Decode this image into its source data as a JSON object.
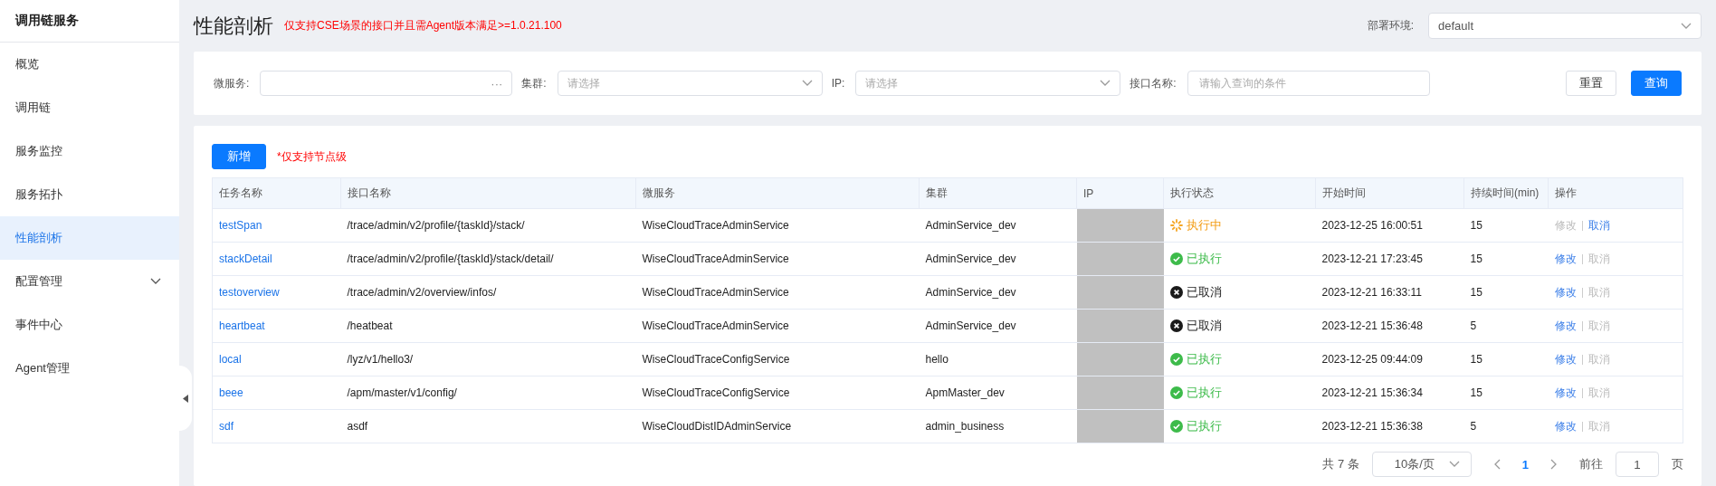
{
  "sidebar": {
    "title": "调用链服务",
    "items": [
      {
        "label": "概览",
        "selected": false
      },
      {
        "label": "调用链",
        "selected": false
      },
      {
        "label": "服务监控",
        "selected": false
      },
      {
        "label": "服务拓扑",
        "selected": false
      },
      {
        "label": "性能剖析",
        "selected": true
      },
      {
        "label": "配置管理",
        "selected": false,
        "expanded": false
      },
      {
        "label": "事件中心",
        "selected": false
      },
      {
        "label": "Agent管理",
        "selected": false
      }
    ]
  },
  "header": {
    "title": "性能剖析",
    "notice": "仅支持CSE场景的接口并且需Agent版本满足>=1.0.21.100",
    "env_label": "部署环境:",
    "env_value": "default"
  },
  "filters": [
    {
      "kind": "picker",
      "label": "微服务:",
      "suffix": "···"
    },
    {
      "kind": "select",
      "label": "集群:",
      "placeholder": "请选择"
    },
    {
      "kind": "select",
      "label": "IP:",
      "placeholder": "请选择"
    },
    {
      "kind": "input",
      "label": "接口名称:",
      "placeholder": "请输入查询的条件"
    }
  ],
  "filter_buttons": {
    "reset": "重置",
    "query": "查询"
  },
  "add_button": "新增",
  "add_note": "*仅支持节点级",
  "table": {
    "columns": [
      "任务名称",
      "接口名称",
      "微服务",
      "集群",
      "IP",
      "执行状态",
      "开始时间",
      "持续时间(min)",
      "操作"
    ],
    "rows": [
      {
        "task": "testSpan",
        "api": "/trace/admin/v2/profile/{taskId}/stack/",
        "service": "WiseCloudTraceAdminService",
        "cluster": "AdminService_dev",
        "status": {
          "kind": "running",
          "text": "执行中"
        },
        "start": "2023-12-25 16:00:51",
        "duration": "15",
        "edit": {
          "label": "修改",
          "disabled": true
        },
        "cancel": {
          "label": "取消",
          "disabled": false
        }
      },
      {
        "task": "stackDetail",
        "api": "/trace/admin/v2/profile/{taskId}/stack/detail/",
        "service": "WiseCloudTraceAdminService",
        "cluster": "AdminService_dev",
        "status": {
          "kind": "done",
          "text": "已执行"
        },
        "start": "2023-12-21 17:23:45",
        "duration": "15",
        "edit": {
          "label": "修改",
          "disabled": false
        },
        "cancel": {
          "label": "取消",
          "disabled": true
        }
      },
      {
        "task": "testoverview",
        "api": "/trace/admin/v2/overview/infos/",
        "service": "WiseCloudTraceAdminService",
        "cluster": "AdminService_dev",
        "status": {
          "kind": "cancelled",
          "text": "已取消"
        },
        "start": "2023-12-21 16:33:11",
        "duration": "15",
        "edit": {
          "label": "修改",
          "disabled": false
        },
        "cancel": {
          "label": "取消",
          "disabled": true
        }
      },
      {
        "task": "heartbeat",
        "api": "/heatbeat",
        "service": "WiseCloudTraceAdminService",
        "cluster": "AdminService_dev",
        "status": {
          "kind": "cancelled",
          "text": "已取消"
        },
        "start": "2023-12-21 15:36:48",
        "duration": "5",
        "edit": {
          "label": "修改",
          "disabled": false
        },
        "cancel": {
          "label": "取消",
          "disabled": true
        }
      },
      {
        "task": "local",
        "api": "/lyz/v1/hello3/",
        "service": "WiseCloudTraceConfigService",
        "cluster": "hello",
        "status": {
          "kind": "done",
          "text": "已执行"
        },
        "start": "2023-12-25 09:44:09",
        "duration": "15",
        "edit": {
          "label": "修改",
          "disabled": false
        },
        "cancel": {
          "label": "取消",
          "disabled": true
        }
      },
      {
        "task": "beee",
        "api": "/apm/master/v1/config/",
        "service": "WiseCloudTraceConfigService",
        "cluster": "ApmMaster_dev",
        "status": {
          "kind": "done",
          "text": "已执行"
        },
        "start": "2023-12-21 15:36:34",
        "duration": "15",
        "edit": {
          "label": "修改",
          "disabled": false
        },
        "cancel": {
          "label": "取消",
          "disabled": true
        }
      },
      {
        "task": "sdf",
        "api": "asdf",
        "service": "WiseCloudDistIDAdminService",
        "cluster": "admin_business",
        "status": {
          "kind": "done",
          "text": "已执行"
        },
        "start": "2023-12-21 15:36:38",
        "duration": "5",
        "edit": {
          "label": "修改",
          "disabled": false
        },
        "cancel": {
          "label": "取消",
          "disabled": true
        }
      }
    ]
  },
  "pagination": {
    "total": "共 7 条",
    "page_size": "10条/页",
    "pages": [
      {
        "label": "1",
        "selected": true
      }
    ],
    "goto_label": "前往",
    "goto_value": "1",
    "page_unit": "页"
  }
}
